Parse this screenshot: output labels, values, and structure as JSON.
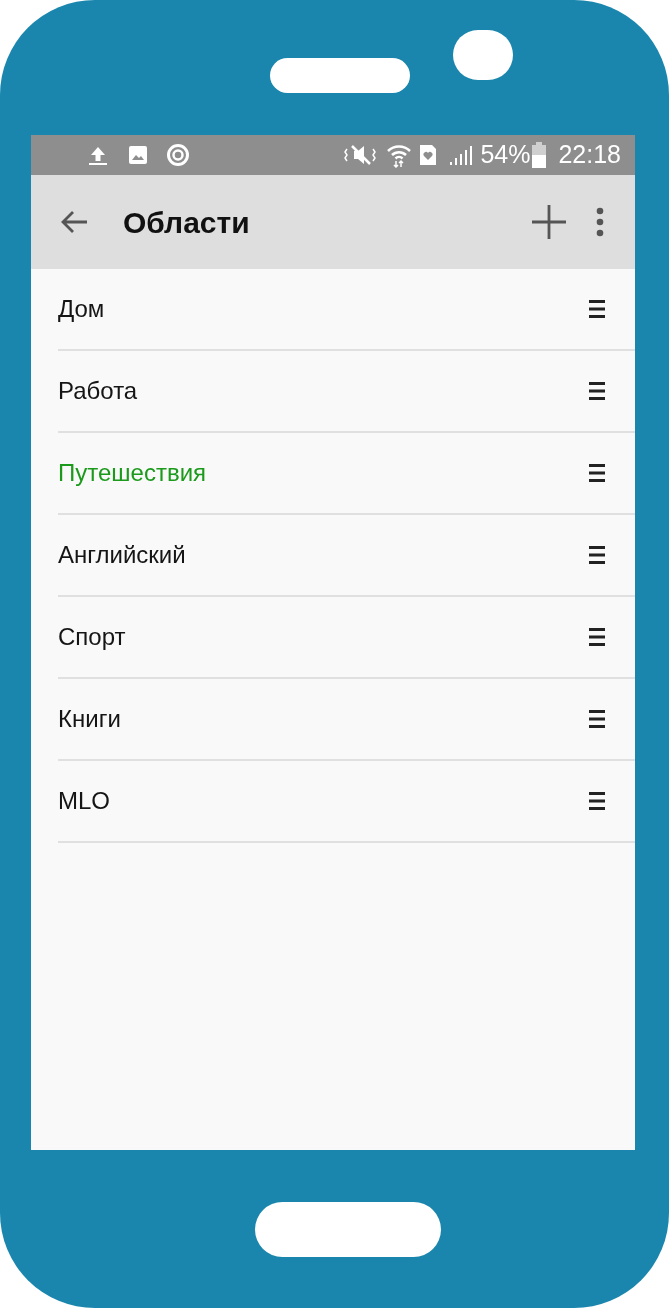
{
  "status_bar": {
    "battery_percent": "54%",
    "time": "22:18"
  },
  "toolbar": {
    "title": "Области"
  },
  "areas": [
    {
      "label": "Дом",
      "selected": false
    },
    {
      "label": "Работа",
      "selected": false
    },
    {
      "label": "Путешествия",
      "selected": true
    },
    {
      "label": "Английский",
      "selected": false
    },
    {
      "label": "Спорт",
      "selected": false
    },
    {
      "label": "Книги",
      "selected": false
    },
    {
      "label": "MLO",
      "selected": false
    }
  ]
}
